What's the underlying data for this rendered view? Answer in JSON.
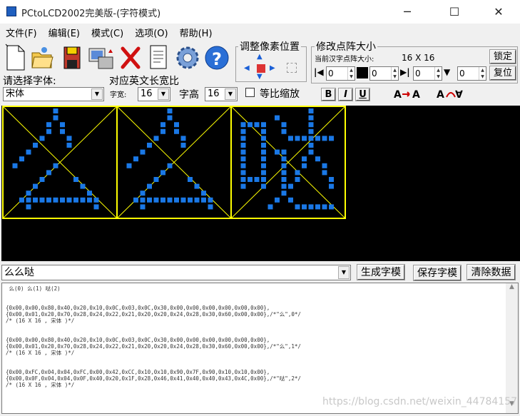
{
  "window": {
    "title": "PCtoLCD2002完美版-(字符模式)"
  },
  "menu": [
    "文件(F)",
    "编辑(E)",
    "模式(C)",
    "选项(O)",
    "帮助(H)"
  ],
  "toolbar": {
    "pixel_group": "调整像素位置",
    "matrix_group": "修改点阵大小",
    "current_size_label": "当前汉字点阵大小:",
    "current_size": "16 X 16",
    "lock_button": "锁定",
    "reset_button": "复位",
    "spin_values": [
      "0",
      "0",
      "0",
      "0"
    ]
  },
  "font": {
    "label": "请选择字体:",
    "value": "宋体",
    "width_group": "对应英文长宽比",
    "width_label": "字宽:",
    "width_value": "16",
    "height_label": "字高",
    "height_value": "16",
    "proportional_label": "等比缩放",
    "bold": "B",
    "italic": "I",
    "underline": "U"
  },
  "text_input": {
    "value": "么么哒"
  },
  "buttons": {
    "generate": "生成字模",
    "save": "保存字模",
    "clear": "清除数据"
  },
  "output": {
    "header": " 么(0) 么(1) 哒(2)",
    "lines": [
      "{0x00,0x00,0x80,0x40,0x20,0x10,0x0C,0x03,0x0C,0x30,0x00,0x00,0x00,0x00,0x00,0x00},",
      "{0x00,0x01,0x20,0x70,0x28,0x24,0x22,0x21,0x20,0x20,0x24,0x28,0x30,0x60,0x00,0x00},/*\"么\",0*/",
      "/* (16 X 16 , 宋体 )*/",
      "",
      "{0x00,0x00,0x80,0x40,0x20,0x10,0x0C,0x03,0x0C,0x30,0x00,0x00,0x00,0x00,0x00,0x00},",
      "{0x00,0x01,0x20,0x70,0x28,0x24,0x22,0x21,0x20,0x20,0x24,0x28,0x30,0x60,0x00,0x00},/*\"么\",1*/",
      "/* (16 X 16 , 宋体 )*/",
      "",
      "{0x00,0xFC,0x04,0x04,0xFC,0x00,0x42,0xCC,0x10,0x10,0x90,0x7F,0x90,0x10,0x10,0x00},",
      "{0x00,0x0F,0x04,0x04,0x0F,0x40,0x20,0x1F,0x28,0x46,0x41,0x40,0x40,0x43,0x4C,0x00},/*\"哒\",2*/",
      "/* (16 X 16 , 宋体 )*/"
    ]
  },
  "watermark": "https://blog.csdn.net/weixin_44784157",
  "colors": {
    "pixel": "#1a78e6",
    "grid_frame": "#ffff00",
    "canvas_bg": "#000000"
  }
}
